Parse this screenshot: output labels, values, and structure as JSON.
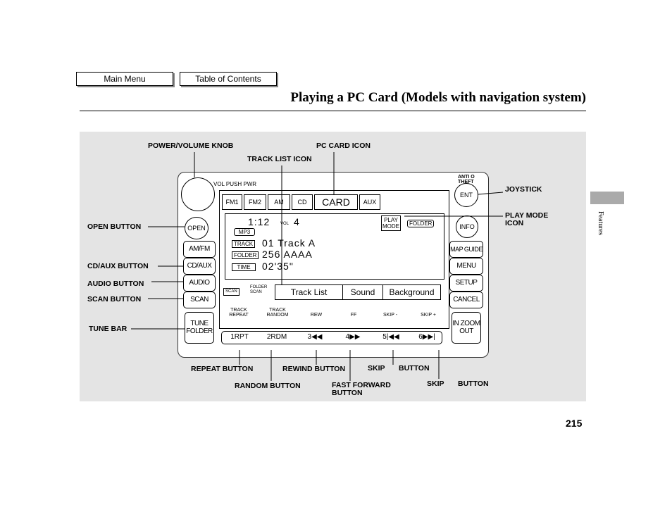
{
  "nav": {
    "main_menu": "Main Menu",
    "toc": "Table of Contents"
  },
  "page_title": "Playing a PC Card (Models with navigation system)",
  "page_number": "215",
  "side_tab": "Features",
  "callouts": {
    "power_volume_knob": "POWER/VOLUME KNOB",
    "pc_card_icon": "PC CARD ICON",
    "track_list_icon": "TRACK LIST ICON",
    "joystick": "JOYSTICK",
    "play_mode_icon_1": "PLAY MODE",
    "play_mode_icon_2": "ICON",
    "open_button": "OPEN BUTTON",
    "cd_aux_button": "CD/AUX BUTTON",
    "audio_button": "AUDIO BUTTON",
    "scan_button": "SCAN BUTTON",
    "tune_bar": "TUNE BAR",
    "repeat_button": "REPEAT BUTTON",
    "rewind_button": "REWIND BUTTON",
    "skip_minus_1": "SKIP",
    "skip_minus_2": "BUTTON",
    "random_button": "RANDOM BUTTON",
    "fast_forward_1": "FAST FORWARD",
    "fast_forward_2": "BUTTON",
    "skip_plus_1": "SKIP",
    "skip_plus_2": "BUTTON"
  },
  "radio": {
    "vol_pwr": "VOL PUSH PWR",
    "anti_theft_1": "ANTI O",
    "anti_theft_2": "THEFT",
    "left_buttons": [
      "OPEN",
      "AM/FM",
      "CD/AUX",
      "AUDIO",
      "SCAN"
    ],
    "tune_folder": "TUNE FOLDER",
    "right_buttons": [
      "ENT",
      "INFO",
      "MAP GUIDE",
      "MENU",
      "SETUP",
      "CANCEL"
    ],
    "zoom": "IN ZOOM OUT",
    "tabs": [
      "FM1",
      "FM2",
      "AM",
      "CD",
      "CARD",
      "AUX"
    ],
    "time": "1:12",
    "vol_label": "VOL",
    "vol_value": "4",
    "play_mode_1": "PLAY",
    "play_mode_2": "MODE",
    "folder_badge": "FOLDER",
    "mp3": "MP3",
    "rows": [
      {
        "tag": "TRACK",
        "value": "01  Track  A"
      },
      {
        "tag": "FOLDER",
        "value": "256 AAAA"
      },
      {
        "tag": "TIME",
        "value": "02'35\""
      }
    ],
    "scan_tag": "SCAN",
    "folder_scan_1": "FOLDER",
    "folder_scan_2": "SCAN",
    "menu": [
      "Track  List",
      "Sound",
      "Background"
    ],
    "softkeys": [
      "TRACK REPEAT",
      "TRACK RANDOM",
      "REW",
      "FF",
      "SKIP -",
      "SKIP +"
    ],
    "presets": [
      "1RPT",
      "2RDM",
      "3◀◀",
      "4▶▶",
      "5|◀◀",
      "6▶▶|"
    ]
  }
}
